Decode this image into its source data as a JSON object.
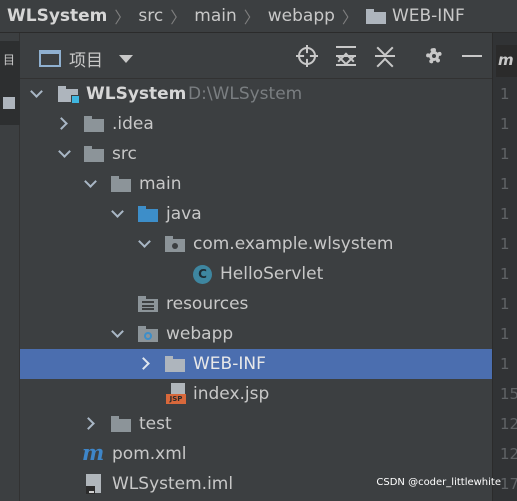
{
  "breadcrumb": {
    "items": [
      "WLSystem",
      "src",
      "main",
      "webapp",
      "WEB-INF"
    ]
  },
  "left_strip": {
    "tab_icon": "project-tool-window-icon",
    "tab_glyph": "目"
  },
  "panel": {
    "title": "项目",
    "icons": [
      "window-icon",
      "chevron-down-icon",
      "locate-target-icon",
      "expand-all-icon",
      "collapse-all-icon",
      "gear-icon",
      "minimize-icon"
    ]
  },
  "tree": {
    "root": {
      "label": "WLSystem",
      "path": "D:\\WLSystem"
    },
    "items": {
      "idea": ".idea",
      "src": "src",
      "main": "main",
      "java": "java",
      "package": "com.example.wlsystem",
      "servlet": "HelloServlet",
      "class_badge": "C",
      "resources": "resources",
      "webapp": "webapp",
      "webinf": "WEB-INF",
      "indexjsp": "index.jsp",
      "jsp_badge": "JSP",
      "test": "test",
      "pom": "pom.xml",
      "maven_badge": "m",
      "iml": "WLSystem.iml"
    },
    "selected": "WEB-INF"
  },
  "editor": {
    "tab_fragment": "m",
    "line_number_fragments": [
      "1",
      "1",
      "1",
      "1",
      "1",
      "1",
      "1",
      "1",
      "1",
      "1",
      "1",
      "1",
      "1",
      "1",
      "15",
      "12",
      "12",
      "17"
    ]
  },
  "watermark": "CSDN @coder_littlewhite",
  "colors": {
    "panel_bg": "#3c3f41",
    "selection": "#4b6eaf",
    "folder_blue": "#3d8ec9",
    "jsp_orange": "#d8683b",
    "module_badge": "#3fb6e0"
  }
}
